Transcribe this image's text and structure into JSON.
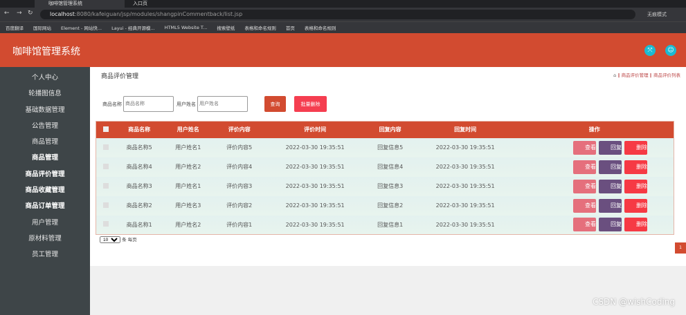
{
  "browser": {
    "tabs": [
      {
        "label": "咖啡馆管理系统"
      },
      {
        "label": "入口页"
      }
    ],
    "url_host": "localhost",
    "url_rest": ":8080/kafeiguan/jsp/modules/shangpinCommentback/list.jsp",
    "incognito": "无痕模式",
    "bookmarks": [
      "百度翻译",
      "国际网站",
      "Element - 网站快...",
      "Layui - 经典开源模...",
      "HTML5 Website T...",
      "搜索壁纸",
      "表格和命名规则",
      "首页",
      "表格和命名规则"
    ]
  },
  "header": {
    "title": "咖啡馆管理系统"
  },
  "sidebar": {
    "items": [
      {
        "label": "个人中心"
      },
      {
        "label": "轮播图信息"
      },
      {
        "label": "基础数据管理"
      },
      {
        "label": "公告管理"
      },
      {
        "label": "商品管理"
      },
      {
        "label": "商品管理",
        "sub": true
      },
      {
        "label": "商品评价管理",
        "sub": true
      },
      {
        "label": "商品收藏管理",
        "sub": true
      },
      {
        "label": "商品订单管理",
        "sub": true
      },
      {
        "label": "用户管理"
      },
      {
        "label": "原材料管理"
      },
      {
        "label": "员工管理"
      }
    ]
  },
  "page": {
    "title": "商品评价管理",
    "breadcrumb": [
      "商品评价管理",
      "商品评价列表"
    ]
  },
  "search": {
    "name_label": "商品名称",
    "name_placeholder": "商品名称",
    "user_label": "用户姓名",
    "user_placeholder": "用户姓名",
    "query": "查询",
    "batch_delete": "批量删除"
  },
  "table": {
    "headers": [
      "商品名称",
      "用户姓名",
      "评价内容",
      "评价时间",
      "回复内容",
      "回复时间",
      "操作"
    ],
    "rows": [
      [
        "商品名称5",
        "用户姓名1",
        "评价内容5",
        "2022-03-30 19:35:51",
        "回复信息5",
        "2022-03-30 19:35:51"
      ],
      [
        "商品名称4",
        "用户姓名2",
        "评价内容4",
        "2022-03-30 19:35:51",
        "回复信息4",
        "2022-03-30 19:35:51"
      ],
      [
        "商品名称3",
        "用户姓名1",
        "评价内容3",
        "2022-03-30 19:35:51",
        "回复信息3",
        "2022-03-30 19:35:51"
      ],
      [
        "商品名称2",
        "用户姓名3",
        "评价内容2",
        "2022-03-30 19:35:51",
        "回复信息2",
        "2022-03-30 19:35:51"
      ],
      [
        "商品名称1",
        "用户姓名2",
        "评价内容1",
        "2022-03-30 19:35:51",
        "回复信息1",
        "2022-03-30 19:35:51"
      ]
    ],
    "actions": {
      "view": "查看",
      "reply": "回复",
      "delete": "删除"
    }
  },
  "pager": {
    "size": "10",
    "per_page": "条 每页",
    "page": "1"
  },
  "watermark": "CSDN @wishCoding"
}
